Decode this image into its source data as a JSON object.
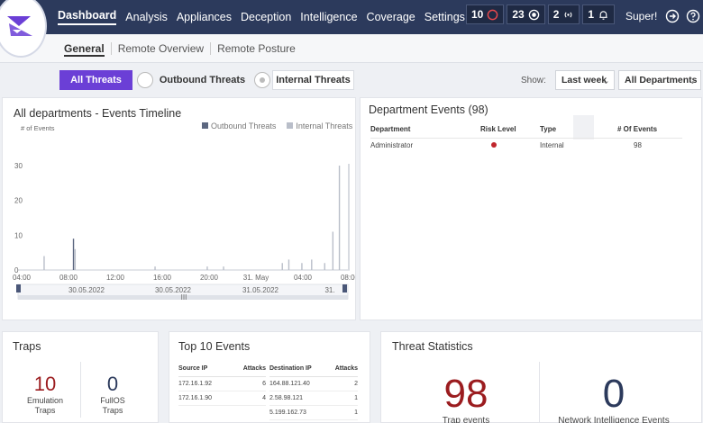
{
  "nav": {
    "items": [
      "Dashboard",
      "Analysis",
      "Appliances",
      "Deception",
      "Intelligence",
      "Coverage",
      "Settings"
    ],
    "badges": [
      {
        "count": "10",
        "icon": "circle-ring-icon",
        "color": "#e5484d"
      },
      {
        "count": "23",
        "icon": "target-icon",
        "color": "#ffffff"
      },
      {
        "count": "2",
        "icon": "broadcast-icon",
        "color": "#ffffff"
      },
      {
        "count": "1",
        "icon": "bell-icon",
        "color": "#ffffff"
      }
    ],
    "user": "Super!"
  },
  "subnav": {
    "tabs": [
      "General",
      "Remote Overview",
      "Remote Posture"
    ]
  },
  "filters": {
    "all": "All Threats",
    "outbound": "Outbound Threats",
    "internal": "Internal Threats",
    "show_label": "Show:",
    "period": "Last week",
    "department": "All Departments"
  },
  "timeline": {
    "title": "All departments - Events Timeline",
    "ylabel": "# of Events",
    "legend": [
      "Outbound Threats",
      "Internal Threats"
    ],
    "yticks": [
      "30",
      "20",
      "10",
      "0"
    ],
    "xticks": [
      "04:00",
      "08:00",
      "12:00",
      "16:00",
      "20:00",
      "31. May",
      "04:00",
      "08:00"
    ],
    "nav_dates": [
      "30.05.2022",
      "30.05.2022",
      "31.05.2022",
      "31."
    ],
    "nav_center": "III"
  },
  "chart_data": {
    "type": "bar",
    "title": "All departments - Events Timeline",
    "ylabel": "# of Events",
    "ylim": [
      0,
      30
    ],
    "categories": [
      "04:00",
      "08:00",
      "12:00",
      "16:00",
      "20:00",
      "31. May",
      "04:00",
      "08:00"
    ],
    "series": [
      {
        "name": "Outbound Threats",
        "values": [
          0,
          0,
          0,
          0,
          0,
          0,
          0,
          0
        ]
      },
      {
        "name": "Internal Threats",
        "values": [
          0,
          3,
          1,
          0,
          0,
          1,
          1,
          4
        ]
      }
    ],
    "spikes": [
      {
        "x": 0.08,
        "v": 4,
        "s": 1
      },
      {
        "x": 0.17,
        "v": 9,
        "s": 0
      },
      {
        "x": 0.175,
        "v": 6,
        "s": 1
      },
      {
        "x": 0.42,
        "v": 1,
        "s": 1
      },
      {
        "x": 0.58,
        "v": 1,
        "s": 1
      },
      {
        "x": 0.63,
        "v": 1,
        "s": 1
      },
      {
        "x": 0.81,
        "v": 2,
        "s": 1
      },
      {
        "x": 0.83,
        "v": 3,
        "s": 1
      },
      {
        "x": 0.87,
        "v": 2,
        "s": 1
      },
      {
        "x": 0.9,
        "v": 3,
        "s": 1
      },
      {
        "x": 0.94,
        "v": 2,
        "s": 1
      },
      {
        "x": 0.965,
        "v": 11,
        "s": 1
      },
      {
        "x": 0.985,
        "v": 30,
        "s": 1
      }
    ],
    "grid": false,
    "legend_position": "top-right"
  },
  "departments": {
    "title": "Department Events (98)",
    "headers": [
      "Department",
      "Risk Level",
      "Type",
      "# Of Events"
    ],
    "rows": [
      {
        "department": "Administrator",
        "risk_color": "#c0262d",
        "type": "Internal",
        "events": "98"
      }
    ]
  },
  "traps": {
    "title": "Traps",
    "emulation_value": "10",
    "emulation_label": "Emulation Traps",
    "fullos_value": "0",
    "fullos_label": "FullOS Traps"
  },
  "top_events": {
    "title": "Top 10 Events",
    "source": {
      "headers": [
        "Source IP",
        "Attacks"
      ],
      "rows": [
        [
          "172.16.1.92",
          "6"
        ],
        [
          "172.16.1.90",
          "4"
        ]
      ]
    },
    "destination": {
      "headers": [
        "Destination IP",
        "Attacks"
      ],
      "rows": [
        [
          "164.88.121.40",
          "2"
        ],
        [
          "2.58.98.121",
          "1"
        ],
        [
          "5.199.162.73",
          "1"
        ]
      ]
    }
  },
  "threat_stats": {
    "title": "Threat Statistics",
    "trap_value": "98",
    "trap_label": "Trap events",
    "trap_color": "#9b1c1f",
    "net_value": "0",
    "net_label": "Network Intelligence Events",
    "net_color": "#2c3a5c"
  }
}
